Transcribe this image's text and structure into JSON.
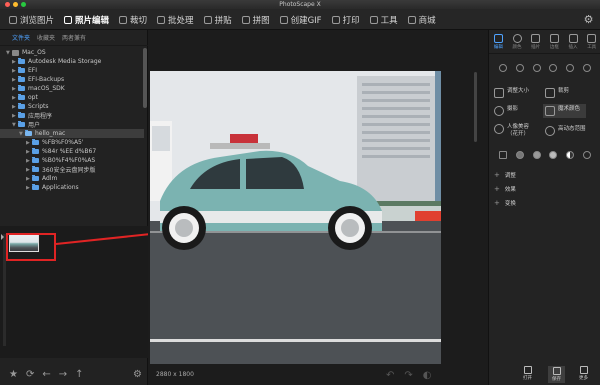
{
  "window": {
    "title": "PhotoScape X",
    "traffic_lights": [
      "#ff5f57",
      "#febc2e",
      "#28c840"
    ]
  },
  "menu": {
    "items": [
      {
        "label": "浏览图片",
        "icon": "grid-icon"
      },
      {
        "label": "照片编辑",
        "icon": "photo-edit-icon"
      },
      {
        "label": "裁切",
        "icon": "crop-icon"
      },
      {
        "label": "批处理",
        "icon": "batch-icon"
      },
      {
        "label": "拼贴",
        "icon": "collage-icon"
      },
      {
        "label": "拼图",
        "icon": "combine-icon"
      },
      {
        "label": "创建GIF",
        "icon": "gif-icon"
      },
      {
        "label": "打印",
        "icon": "print-icon"
      },
      {
        "label": "工具",
        "icon": "tools-icon"
      },
      {
        "label": "商城",
        "icon": "store-icon"
      }
    ],
    "active_index": 1,
    "accent_color": "#4fa3ff"
  },
  "left_panel": {
    "tabs": [
      "文件夹",
      "收藏夹",
      "两者兼有"
    ],
    "tree": [
      {
        "label": "Mac_OS",
        "depth": 0,
        "kind": "disk"
      },
      {
        "label": "Autodesk Media Storage",
        "depth": 1,
        "kind": "folder"
      },
      {
        "label": "EFI",
        "depth": 1,
        "kind": "folder"
      },
      {
        "label": "EFI-Backups",
        "depth": 1,
        "kind": "folder"
      },
      {
        "label": "macOS_SDK",
        "depth": 1,
        "kind": "folder"
      },
      {
        "label": "opt",
        "depth": 1,
        "kind": "folder"
      },
      {
        "label": "Scripts",
        "depth": 1,
        "kind": "folder"
      },
      {
        "label": "应用程序",
        "depth": 1,
        "kind": "folder"
      },
      {
        "label": "用户",
        "depth": 1,
        "kind": "folder"
      },
      {
        "label": "hello_mac",
        "depth": 2,
        "kind": "home",
        "selected": true
      },
      {
        "label": "%FB%F0%A5'",
        "depth": 3,
        "kind": "folder"
      },
      {
        "label": "%84r %EE d%B67",
        "depth": 3,
        "kind": "folder"
      },
      {
        "label": "%B0%F4%F0%AS",
        "depth": 3,
        "kind": "folder"
      },
      {
        "label": "360安全云盘同步版",
        "depth": 3,
        "kind": "folder"
      },
      {
        "label": "Adlm",
        "depth": 3,
        "kind": "folder"
      },
      {
        "label": "Applications",
        "depth": 3,
        "kind": "folder"
      }
    ],
    "bottom_icons": [
      "star-icon",
      "refresh-icon",
      "back-icon",
      "forward-icon",
      "up-icon",
      "settings-icon"
    ],
    "callout_color": "#e02424"
  },
  "center": {
    "image_size_text": "2880 x 1800"
  },
  "right_panel": {
    "tabs": [
      {
        "label": "编辑",
        "icon": "edit-icon"
      },
      {
        "label": "颜色",
        "icon": "color-icon"
      },
      {
        "label": "插片",
        "icon": "insert-icon"
      },
      {
        "label": "边框",
        "icon": "border-icon"
      },
      {
        "label": "插入",
        "icon": "sticker-icon"
      },
      {
        "label": "工具",
        "icon": "tools-icon"
      }
    ],
    "active_tab": 0,
    "tools": [
      {
        "label": "调整大小",
        "icon": "resize-icon"
      },
      {
        "label": "裁剪",
        "icon": "crop-icon"
      },
      {
        "label": "摄影",
        "icon": "camera-icon"
      },
      {
        "label": "魔术颜色",
        "icon": "magic-color-icon",
        "highlighted": true
      },
      {
        "label": "人像美容（花开）",
        "icon": "portrait-icon"
      },
      {
        "label": "高动态范围",
        "icon": "hdr-icon"
      }
    ],
    "sections": [
      "调整",
      "效果",
      "变换"
    ],
    "bottom_buttons": [
      {
        "label": "打开",
        "icon": "open-icon"
      },
      {
        "label": "保存",
        "icon": "save-icon",
        "highlighted": true
      },
      {
        "label": "更多",
        "icon": "more-icon"
      }
    ]
  }
}
